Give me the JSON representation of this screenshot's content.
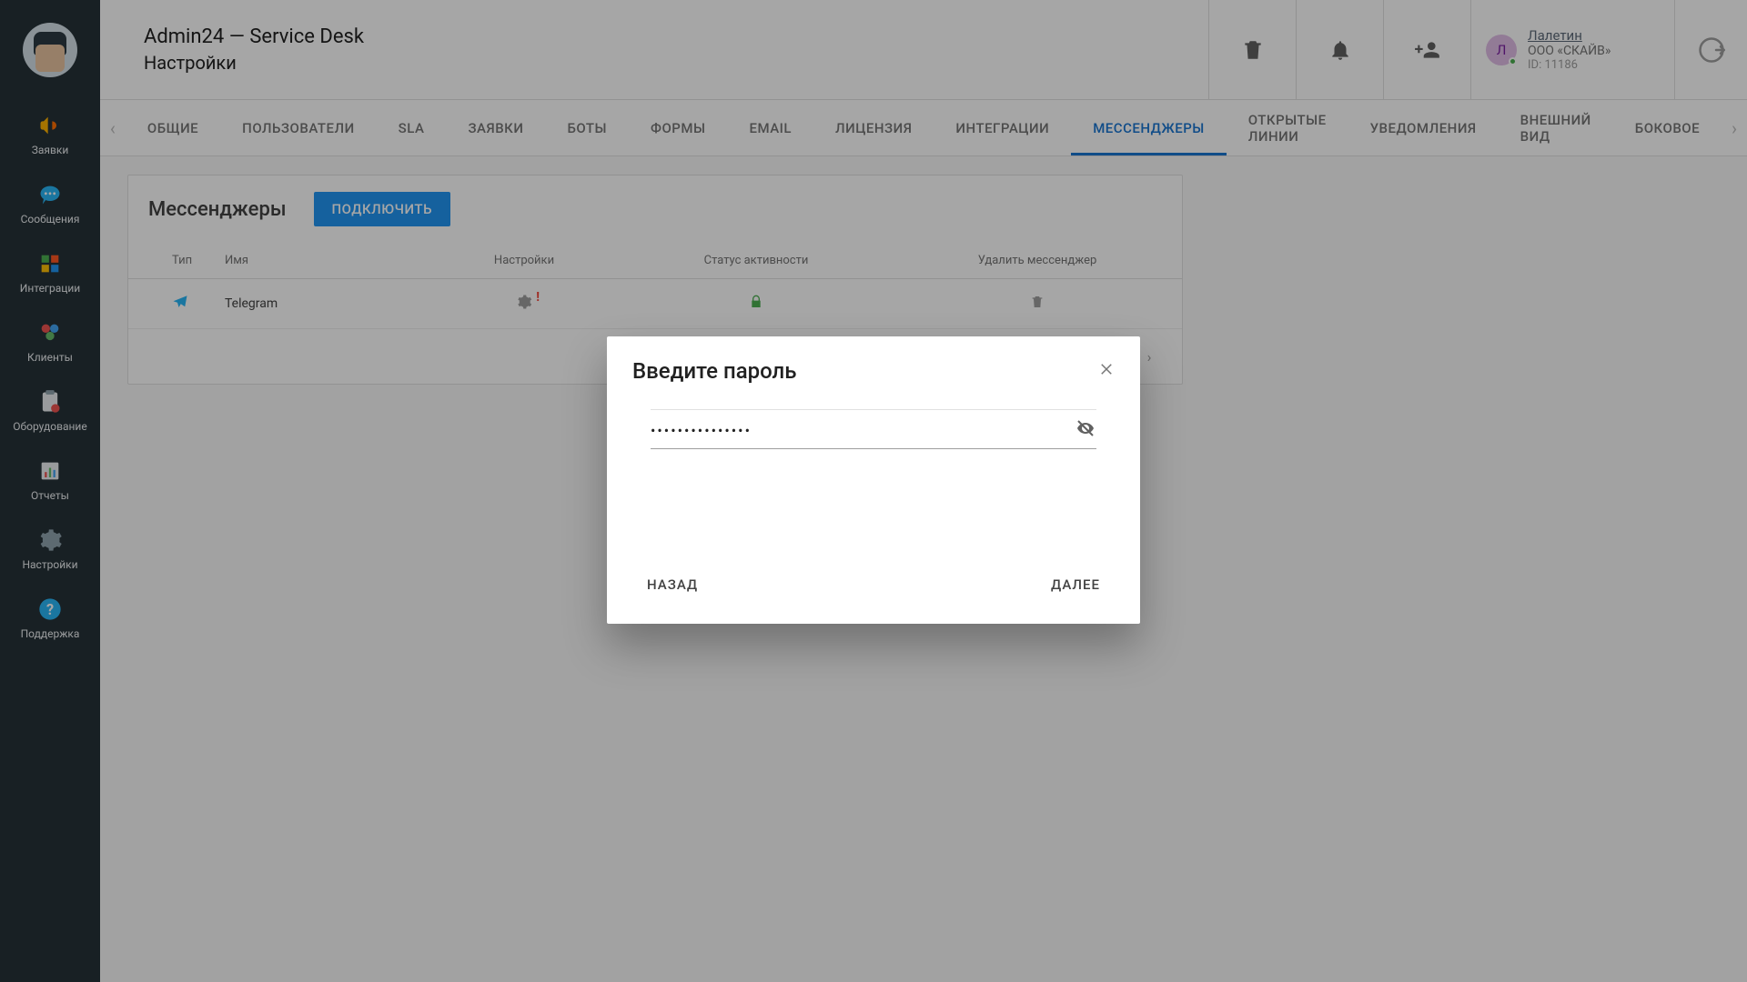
{
  "header": {
    "title": "Admin24 — Service Desk",
    "subtitle": "Настройки"
  },
  "user": {
    "initial": "Л",
    "name": "Лалетин",
    "org": "ООО «СКАЙВ»",
    "id": "ID: 11186"
  },
  "sidebar": {
    "items": [
      {
        "label": "Заявки"
      },
      {
        "label": "Сообщения"
      },
      {
        "label": "Интеграции"
      },
      {
        "label": "Клиенты"
      },
      {
        "label": "Оборудование"
      },
      {
        "label": "Отчеты"
      },
      {
        "label": "Настройки"
      },
      {
        "label": "Поддержка"
      }
    ]
  },
  "tabs": [
    {
      "label": "ОБЩИЕ"
    },
    {
      "label": "ПОЛЬЗОВАТЕЛИ"
    },
    {
      "label": "SLA"
    },
    {
      "label": "ЗАЯВКИ"
    },
    {
      "label": "БОТЫ"
    },
    {
      "label": "ФОРМЫ"
    },
    {
      "label": "EMAIL"
    },
    {
      "label": "ЛИЦЕНЗИЯ"
    },
    {
      "label": "ИНТЕГРАЦИИ"
    },
    {
      "label": "МЕССЕНДЖЕРЫ",
      "active": true
    },
    {
      "label": "ОТКРЫТЫЕ ЛИНИИ"
    },
    {
      "label": "УВЕДОМЛЕНИЯ"
    },
    {
      "label": "ВНЕШНИЙ ВИД"
    },
    {
      "label": "БОКОВОЕ"
    }
  ],
  "panel": {
    "title": "Мессенджеры",
    "connect_btn": "ПОДКЛЮЧИТЬ",
    "columns": {
      "type": "Тип",
      "name": "Имя",
      "settings": "Настройки",
      "activity": "Статус активности",
      "delete": "Удалить мессенджер"
    },
    "rows": [
      {
        "name": "Telegram"
      }
    ]
  },
  "dialog": {
    "title": "Введите пароль",
    "password_value": "•••••••••••••••",
    "back_btn": "НАЗАД",
    "next_btn": "ДАЛЕЕ"
  }
}
